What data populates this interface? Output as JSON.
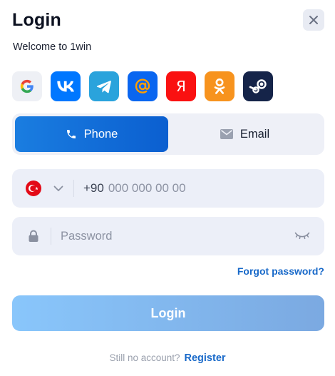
{
  "header": {
    "title": "Login",
    "subtitle": "Welcome to 1win",
    "close_icon": "close-icon"
  },
  "social": [
    {
      "name": "google",
      "icon": "google-icon"
    },
    {
      "name": "vk",
      "icon": "vk-icon",
      "label": "VK"
    },
    {
      "name": "telegram",
      "icon": "telegram-icon"
    },
    {
      "name": "mail",
      "icon": "at-sign-icon",
      "label": "@"
    },
    {
      "name": "yandex",
      "icon": "yandex-icon",
      "label": "Я"
    },
    {
      "name": "odnoklassniki",
      "icon": "ok-icon"
    },
    {
      "name": "steam",
      "icon": "steam-icon"
    }
  ],
  "tabs": [
    {
      "label": "Phone",
      "icon": "phone-icon",
      "active": true
    },
    {
      "label": "Email",
      "icon": "envelope-icon",
      "active": false
    }
  ],
  "phone_field": {
    "country_flag": "turkey-flag-icon",
    "prefix": "+90",
    "placeholder": "000 000 00 00",
    "value": ""
  },
  "password_field": {
    "placeholder": "Password",
    "value": "",
    "icon": "lock-icon",
    "toggle_icon": "eye-closed-icon"
  },
  "forgot_label": "Forgot password?",
  "login_label": "Login",
  "footer": {
    "question": "Still no account?",
    "register_label": "Register"
  },
  "colors": {
    "primary": "#0b5fd0",
    "link": "#1869c9",
    "field_bg": "#eceff8",
    "login_disabled": "#89c6fb"
  }
}
